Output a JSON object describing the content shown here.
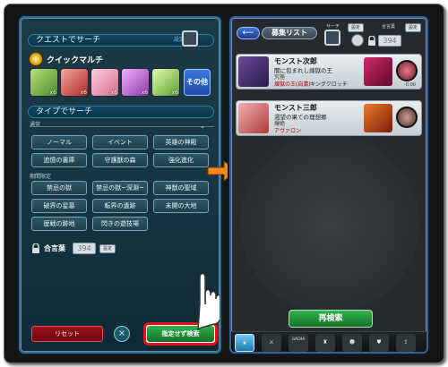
{
  "left": {
    "quest_search_label": "クエストでサーチ",
    "settings_hint": "設定中",
    "quick_multi_label": "クイックマルチ",
    "monsters": [
      {
        "count": "x6",
        "color": "#7fb84a"
      },
      {
        "count": "x6",
        "color": "#d94a42"
      },
      {
        "count": "x6",
        "color": "#e895b2"
      },
      {
        "count": "x6",
        "color": "#c86ad8"
      },
      {
        "count": "x6",
        "color": "#9fd46a"
      }
    ],
    "other_label": "その他",
    "type_search_label": "タイプでサーチ",
    "normal_label": "通常",
    "normal_buttons": [
      "ノーマル",
      "イベント",
      "英雄の神殿",
      "追憶の書庫",
      "守護獣の森",
      "強化進化"
    ],
    "limited_label": "期間限定",
    "limited_buttons": [
      "禁忌の獄",
      "禁忌の獄~深淵~",
      "神獣の聖域",
      "破界の星墓",
      "転界の遺跡",
      "未開の大地",
      "歴戦の跡地",
      "閃きの遊技場"
    ],
    "password_label": "合言葉",
    "password_value": "394",
    "settings_button": "設定",
    "reset_button": "リセット",
    "close_symbol": "×",
    "unspecified_search_button": "指定せず検索"
  },
  "right": {
    "back_symbol": "⟵",
    "title": "募集リスト",
    "search_label": "サーチ",
    "settings_button": "設定",
    "password_label": "合言葉",
    "password_value": "394",
    "cards": [
      {
        "name": "モンスト次郎",
        "line1": "闇に包まれし煉獄の王",
        "line2": "究極",
        "tag": "煉獄の王(自粛)",
        "tag2": "キングクロッチ",
        "time": "-0:00"
      },
      {
        "name": "モンスト三郎",
        "line1": "渇望の果ての理想郷",
        "line2": "爆絶",
        "tag": "アヴァロン",
        "tag2": "",
        "time": ""
      }
    ],
    "research_button": "再検索",
    "tabs": [
      "★",
      "⚔",
      "GACHA",
      "♜",
      "☻",
      "⛊",
      "⇪"
    ]
  },
  "colors": {
    "accent_red": "#e8101e",
    "green_button": "#33b24a",
    "blue_button": "#3b78e0",
    "arrow": "#f08a1c"
  }
}
